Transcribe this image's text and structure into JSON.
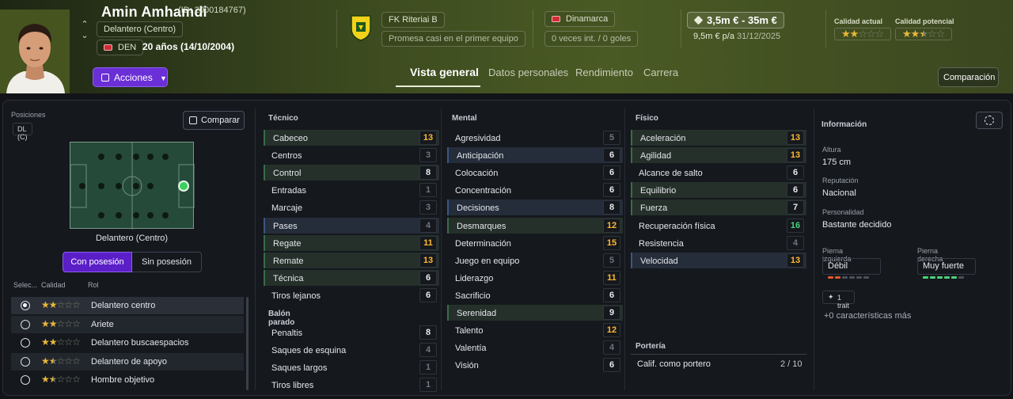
{
  "player": {
    "name": "Amin Amhamdi",
    "id": "(ID: 2000184767)",
    "position": "Delantero (Centro)",
    "nation_code": "DEN",
    "age": "20 años (14/10/2004)",
    "club": "FK Riteriai B",
    "squad_status": "Promesa casi en el primer equipo",
    "country": "Dinamarca",
    "caps": "0 veces int. / 0 goles",
    "value": "3,5m € - 35m €",
    "wage": "9,5m € p/a",
    "contract_end": "31/12/2025",
    "current_ability_label": "Calidad actual",
    "potential_ability_label": "Calidad potencial",
    "current_ability_stars": 2,
    "potential_ability_stars": 2.5
  },
  "header": {
    "actions_label": "Acciones",
    "compare_label": "Comparación",
    "tabs": [
      "Vista general",
      "Datos personales",
      "Rendimiento",
      "Carrera"
    ],
    "active_tab": "Vista general"
  },
  "left": {
    "positions_label": "Posiciones",
    "position_chip": "DL (C)",
    "compare_button": "Comparar",
    "pitch_label": "Delantero (Centro)",
    "toggle_on": "Con posesión",
    "toggle_off": "Sin posesión",
    "role_headers": [
      "Selec...",
      "Calidad",
      "Rol"
    ],
    "roles": [
      {
        "name": "Delantero centro",
        "stars": 2,
        "selected": true
      },
      {
        "name": "Ariete",
        "stars": 2,
        "selected": false
      },
      {
        "name": "Delantero buscaespacios",
        "stars": 2,
        "selected": false
      },
      {
        "name": "Delantero de apoyo",
        "stars": 1.5,
        "selected": false
      },
      {
        "name": "Hombre objetivo",
        "stars": 1.5,
        "selected": false
      }
    ]
  },
  "attributes": {
    "tecnico_label": "Técnico",
    "tecnico": [
      {
        "name": "Cabeceo",
        "value": 13,
        "hl": "g"
      },
      {
        "name": "Centros",
        "value": 3,
        "hl": ""
      },
      {
        "name": "Control",
        "value": 8,
        "hl": "g"
      },
      {
        "name": "Entradas",
        "value": 1,
        "hl": ""
      },
      {
        "name": "Marcaje",
        "value": 3,
        "hl": ""
      },
      {
        "name": "Pases",
        "value": 4,
        "hl": "b"
      },
      {
        "name": "Regate",
        "value": 11,
        "hl": "g"
      },
      {
        "name": "Remate",
        "value": 13,
        "hl": "g"
      },
      {
        "name": "Técnica",
        "value": 6,
        "hl": "g"
      },
      {
        "name": "Tiros lejanos",
        "value": 6,
        "hl": ""
      }
    ],
    "balon_label": "Balón parado",
    "balon": [
      {
        "name": "Penaltis",
        "value": 8,
        "hl": ""
      },
      {
        "name": "Saques de esquina",
        "value": 4,
        "hl": ""
      },
      {
        "name": "Saques largos",
        "value": 1,
        "hl": ""
      },
      {
        "name": "Tiros libres",
        "value": 1,
        "hl": ""
      }
    ],
    "mental_label": "Mental",
    "mental": [
      {
        "name": "Agresividad",
        "value": 5,
        "hl": ""
      },
      {
        "name": "Anticipación",
        "value": 6,
        "hl": "b"
      },
      {
        "name": "Colocación",
        "value": 6,
        "hl": ""
      },
      {
        "name": "Concentración",
        "value": 6,
        "hl": ""
      },
      {
        "name": "Decisiones",
        "value": 8,
        "hl": "b"
      },
      {
        "name": "Desmarques",
        "value": 12,
        "hl": "g"
      },
      {
        "name": "Determinación",
        "value": 15,
        "hl": ""
      },
      {
        "name": "Juego en equipo",
        "value": 5,
        "hl": ""
      },
      {
        "name": "Liderazgo",
        "value": 11,
        "hl": ""
      },
      {
        "name": "Sacrificio",
        "value": 6,
        "hl": ""
      },
      {
        "name": "Serenidad",
        "value": 9,
        "hl": "g"
      },
      {
        "name": "Talento",
        "value": 12,
        "hl": ""
      },
      {
        "name": "Valentía",
        "value": 4,
        "hl": ""
      },
      {
        "name": "Visión",
        "value": 6,
        "hl": ""
      }
    ],
    "fisico_label": "Físico",
    "fisico": [
      {
        "name": "Aceleración",
        "value": 13,
        "hl": "g"
      },
      {
        "name": "Agilidad",
        "value": 13,
        "hl": "g"
      },
      {
        "name": "Alcance de salto",
        "value": 6,
        "hl": ""
      },
      {
        "name": "Equilibrio",
        "value": 6,
        "hl": "g"
      },
      {
        "name": "Fuerza",
        "value": 7,
        "hl": "g"
      },
      {
        "name": "Recuperación física",
        "value": 16,
        "hl": ""
      },
      {
        "name": "Resistencia",
        "value": 4,
        "hl": ""
      },
      {
        "name": "Velocidad",
        "value": 13,
        "hl": "b"
      }
    ],
    "porteria_label": "Portería",
    "gk_rating_label": "Calif. como portero",
    "gk_rating": "2 / 10"
  },
  "info": {
    "title": "Información",
    "height_label": "Altura",
    "height": "175 cm",
    "reputation_label": "Reputación",
    "reputation": "Nacional",
    "personality_label": "Personalidad",
    "personality": "Bastante decidido",
    "left_foot_label": "Pierna izquierda",
    "left_foot": "Débil",
    "right_foot_label": "Pierna derecha",
    "right_foot": "Muy fuerte",
    "trait_chip": "1 trait",
    "more_traits": "+0 características más",
    "left_foot_level": 2,
    "right_foot_level": 5,
    "foot_colors": {
      "weak": "#e05a2b",
      "strong": "#4ad37a",
      "empty": "#4a505a"
    }
  }
}
